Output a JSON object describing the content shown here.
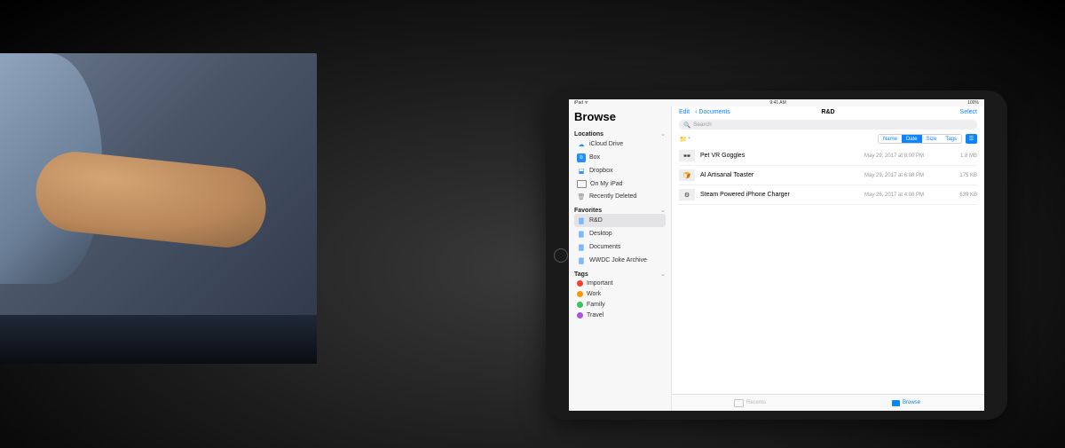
{
  "status": {
    "carrier": "iPad ᯤ",
    "time": "9:41 AM",
    "battery": "100%"
  },
  "sidebar": {
    "title": "Browse",
    "locations_label": "Locations",
    "locations": [
      {
        "label": "iCloud Drive"
      },
      {
        "label": "Box"
      },
      {
        "label": "Dropbox"
      },
      {
        "label": "On My iPad"
      },
      {
        "label": "Recently Deleted"
      }
    ],
    "favorites_label": "Favorites",
    "favorites": [
      {
        "label": "R&D"
      },
      {
        "label": "Desktop"
      },
      {
        "label": "Documents"
      },
      {
        "label": "WWDC Joke Archive"
      }
    ],
    "tags_label": "Tags",
    "tags": [
      {
        "label": "Important",
        "color": "#ff3b30"
      },
      {
        "label": "Work",
        "color": "#ff9500"
      },
      {
        "label": "Family",
        "color": "#34c759"
      },
      {
        "label": "Travel",
        "color": "#af52de"
      }
    ]
  },
  "nav": {
    "edit": "Edit",
    "back": "Documents",
    "title": "R&D",
    "select": "Select"
  },
  "search": {
    "placeholder": "Search"
  },
  "sort": {
    "options": [
      "Name",
      "Date",
      "Size",
      "Tags"
    ],
    "active": "Date"
  },
  "files": [
    {
      "name": "Pet VR Goggles",
      "date": "May 29, 2017 at 8:00 PM",
      "size": "1.8 MB"
    },
    {
      "name": "AI Artisanal Toaster",
      "date": "May 29, 2017 at 6:08 PM",
      "size": "175 KB"
    },
    {
      "name": "Steam Powered iPhone Charger",
      "date": "May 26, 2017 at 4:08 PM",
      "size": "639 KB"
    }
  ],
  "tabs": {
    "recents": "Recents",
    "browse": "Browse"
  }
}
